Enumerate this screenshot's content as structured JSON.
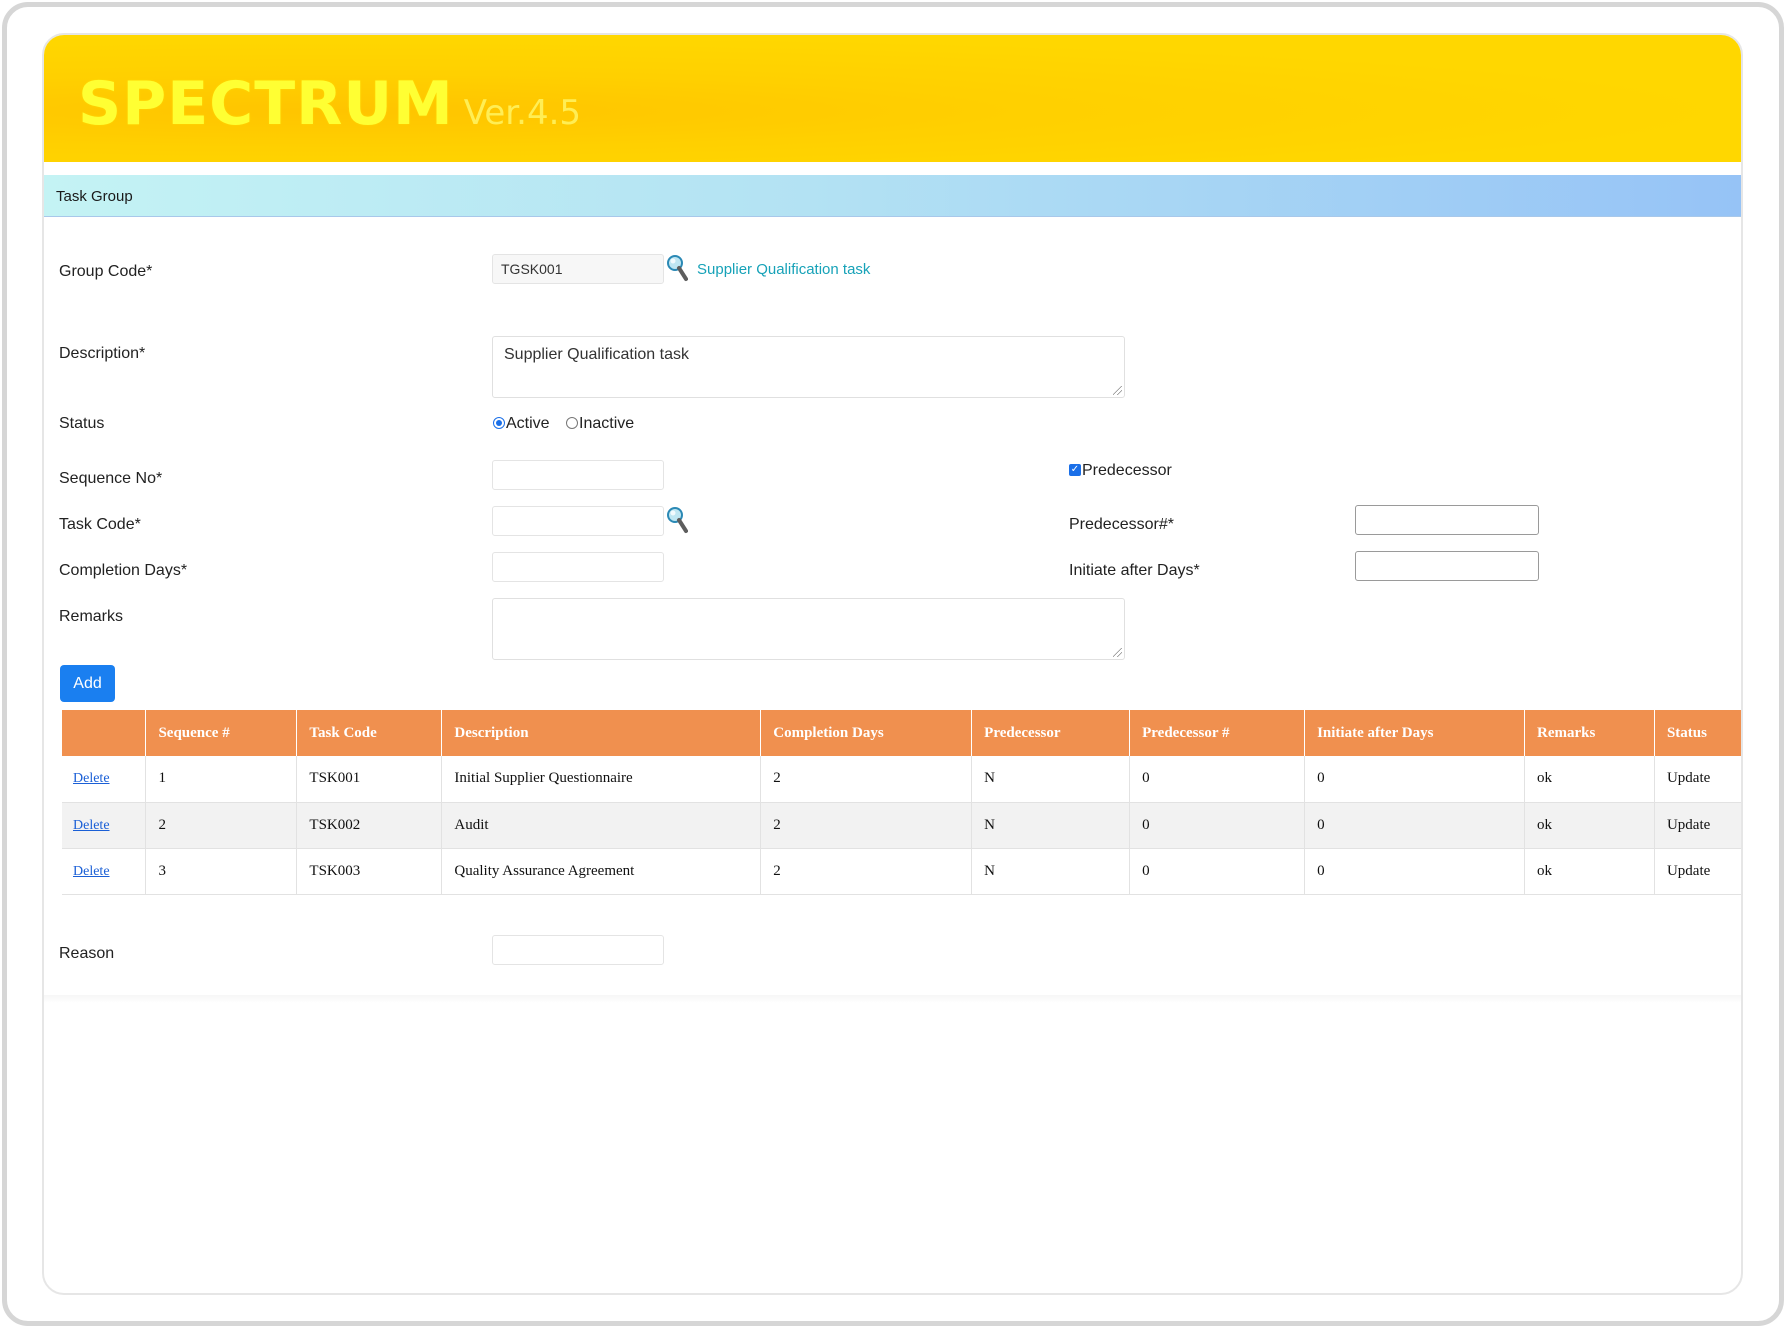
{
  "app": {
    "name": "SPECTRUM",
    "version": "Ver.4.5"
  },
  "section": {
    "title": "Task Group"
  },
  "form": {
    "group_code": {
      "label": "Group Code*",
      "value": "TGSK001",
      "lookup_text": "Supplier Qualification task"
    },
    "description": {
      "label": "Description*",
      "value": "Supplier Qualification task"
    },
    "status": {
      "label": "Status",
      "options": [
        "Active",
        "Inactive"
      ],
      "selected": "Active"
    },
    "sequence_no": {
      "label": "Sequence No*",
      "value": ""
    },
    "predecessor": {
      "label": "Predecessor",
      "checked": true
    },
    "task_code": {
      "label": "Task Code*",
      "value": ""
    },
    "predecessor_no": {
      "label": "Predecessor#*",
      "value": ""
    },
    "completion_days": {
      "label": "Completion Days*",
      "value": ""
    },
    "initiate_after_days": {
      "label": "Initiate after Days*",
      "value": ""
    },
    "remarks": {
      "label": "Remarks",
      "value": ""
    },
    "add_label": "Add",
    "reason": {
      "label": "Reason",
      "value": ""
    }
  },
  "table": {
    "columns": [
      "",
      "Sequence #",
      "Task Code",
      "Description",
      "Completion Days",
      "Predecessor",
      "Predecessor #",
      "Initiate after Days",
      "Remarks",
      "Status"
    ],
    "rows": [
      {
        "action": "Delete",
        "seq": "1",
        "task_code": "TSK001",
        "description": "Initial Supplier Questionnaire",
        "completion_days": "2",
        "predecessor": "N",
        "predecessor_no": "0",
        "initiate_after": "0",
        "remarks": "ok",
        "status": "Update"
      },
      {
        "action": "Delete",
        "seq": "2",
        "task_code": "TSK002",
        "description": "Audit",
        "completion_days": "2",
        "predecessor": "N",
        "predecessor_no": "0",
        "initiate_after": "0",
        "remarks": "ok",
        "status": "Update"
      },
      {
        "action": "Delete",
        "seq": "3",
        "task_code": "TSK003",
        "description": "Quality Assurance Agreement",
        "completion_days": "2",
        "predecessor": "N",
        "predecessor_no": "0",
        "initiate_after": "0",
        "remarks": "ok",
        "status": "Update"
      }
    ]
  },
  "colors": {
    "banner": "#ffd700",
    "brand_text": "#ffff33",
    "table_header": "#f0904f",
    "add_button": "#1a7ff0",
    "lookup_link": "#17a2b8"
  },
  "icons": {
    "lookup": "magnifier-icon"
  }
}
